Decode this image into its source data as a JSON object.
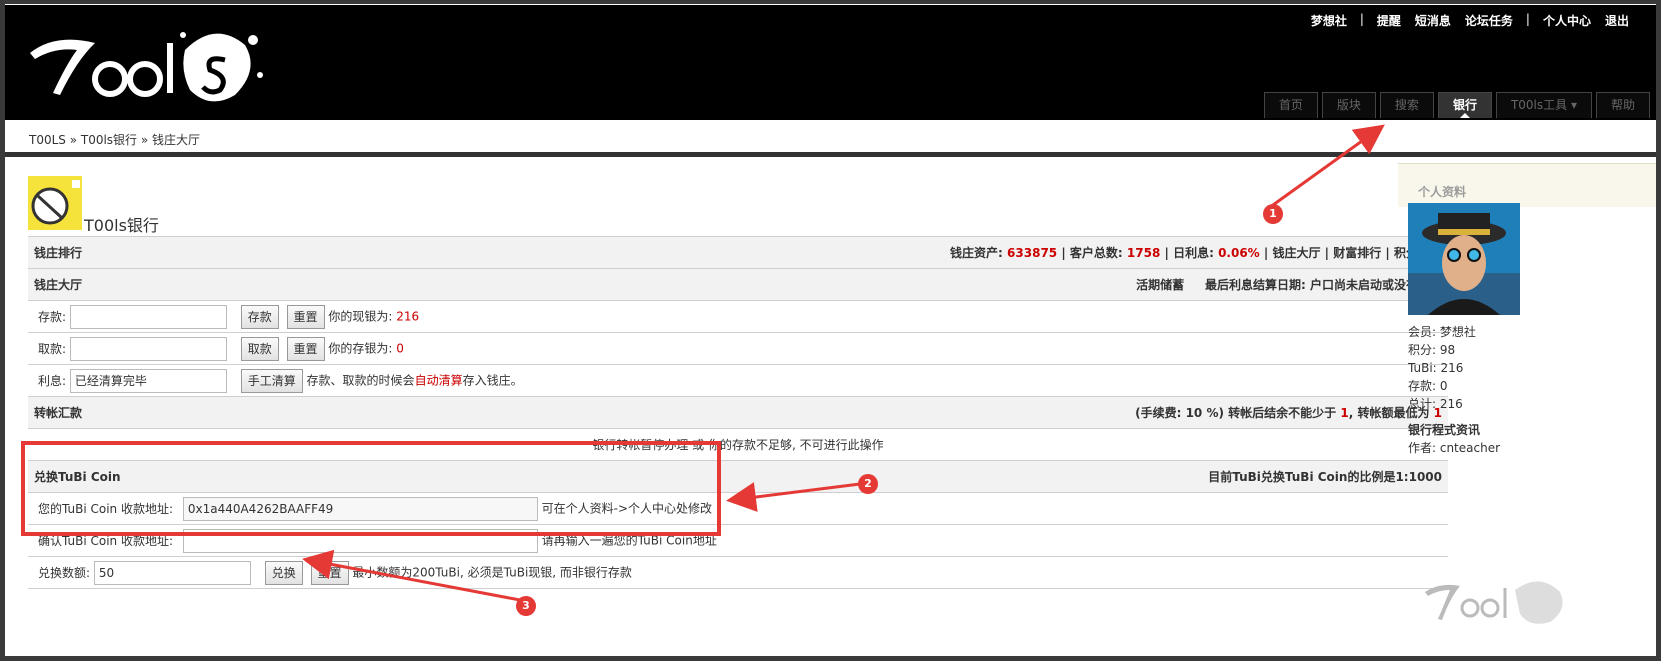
{
  "header": {
    "top_links": [
      "梦想社",
      "提醒",
      "短消息",
      "论坛任务",
      "个人中心",
      "退出"
    ],
    "nav_tabs": [
      "首页",
      "版块",
      "搜索",
      "银行",
      "T00ls工具 ▾",
      "帮助"
    ],
    "active_tab": "银行"
  },
  "breadcrumb": "T00LS » T00ls银行 » 钱庄大厅",
  "bank": {
    "title": "T00ls银行",
    "rank_section": {
      "label": "钱庄排行",
      "assets_label": "钱庄资产:",
      "assets": "633875",
      "customers_label": "客户总数:",
      "customers": "1758",
      "rate_label": "日利息:",
      "rate": "0.06%",
      "links": [
        "钱庄大厅",
        "财富排行",
        "积分兑换"
      ]
    },
    "hall_section": {
      "label": "钱庄大厅",
      "savings_type": "活期储蓄",
      "last_date_label": "最后利息结算日期:",
      "last_date": "户口尚未启动或没有存款"
    },
    "deposit": {
      "label": "存款:",
      "button": "存款",
      "reset": "重置",
      "info_label": "你的现银为:",
      "info_value": "216"
    },
    "withdraw": {
      "label": "取款:",
      "button": "取款",
      "reset": "重置",
      "info_label": "你的存银为:",
      "info_value": "0"
    },
    "interest": {
      "label": "利息:",
      "value": "已经清算完毕",
      "button": "手工清算",
      "note_pre": "存款、取款的时候会",
      "note_link": "自动清算",
      "note_post": "存入钱庄。"
    },
    "transfer_section": {
      "label": "转帐汇款",
      "fee_pre": "(手续费: 10 %) 转帐后结余不能少于",
      "fee_min": "1",
      "fee_mid": ", 转帐额最低为",
      "fee_min2": "1",
      "notice": "银行转帐暂停办理 或 你的存款不足够, 不可进行此操作"
    },
    "exchange_section": {
      "label": "兑换TuBi Coin",
      "ratio": "目前TuBi兑换TuBi Coin的比例是1:1000",
      "address_label": "您的TuBi Coin 收款地址:",
      "address_value": "0x1a440A4262BAAFF49",
      "address_note": "可在个人资料->个人中心处修改",
      "confirm_label": "确认TuBi Coin 收款地址:",
      "confirm_note": "请再输入一遍您的TuBi Coin地址",
      "amount_label": "兑换数额:",
      "amount_value": "50",
      "exchange_button": "兑换",
      "reset_button": "重置",
      "amount_note": "最小数额为200TuBi, 必须是TuBi现银, 而非银行存款"
    }
  },
  "sidebar": {
    "title": "个人资料",
    "info": [
      "会员: 梦想社",
      "积分: 98",
      "TuBi: 216",
      "存款: 0",
      "总计: 216"
    ],
    "program_title": "银行程式资讯",
    "author": "作者: cnteacher"
  },
  "annotations": [
    "1",
    "2",
    "3"
  ],
  "colors": {
    "accent_red": "#e53935",
    "value_red": "#cc0000",
    "header_bg": "#000000"
  }
}
